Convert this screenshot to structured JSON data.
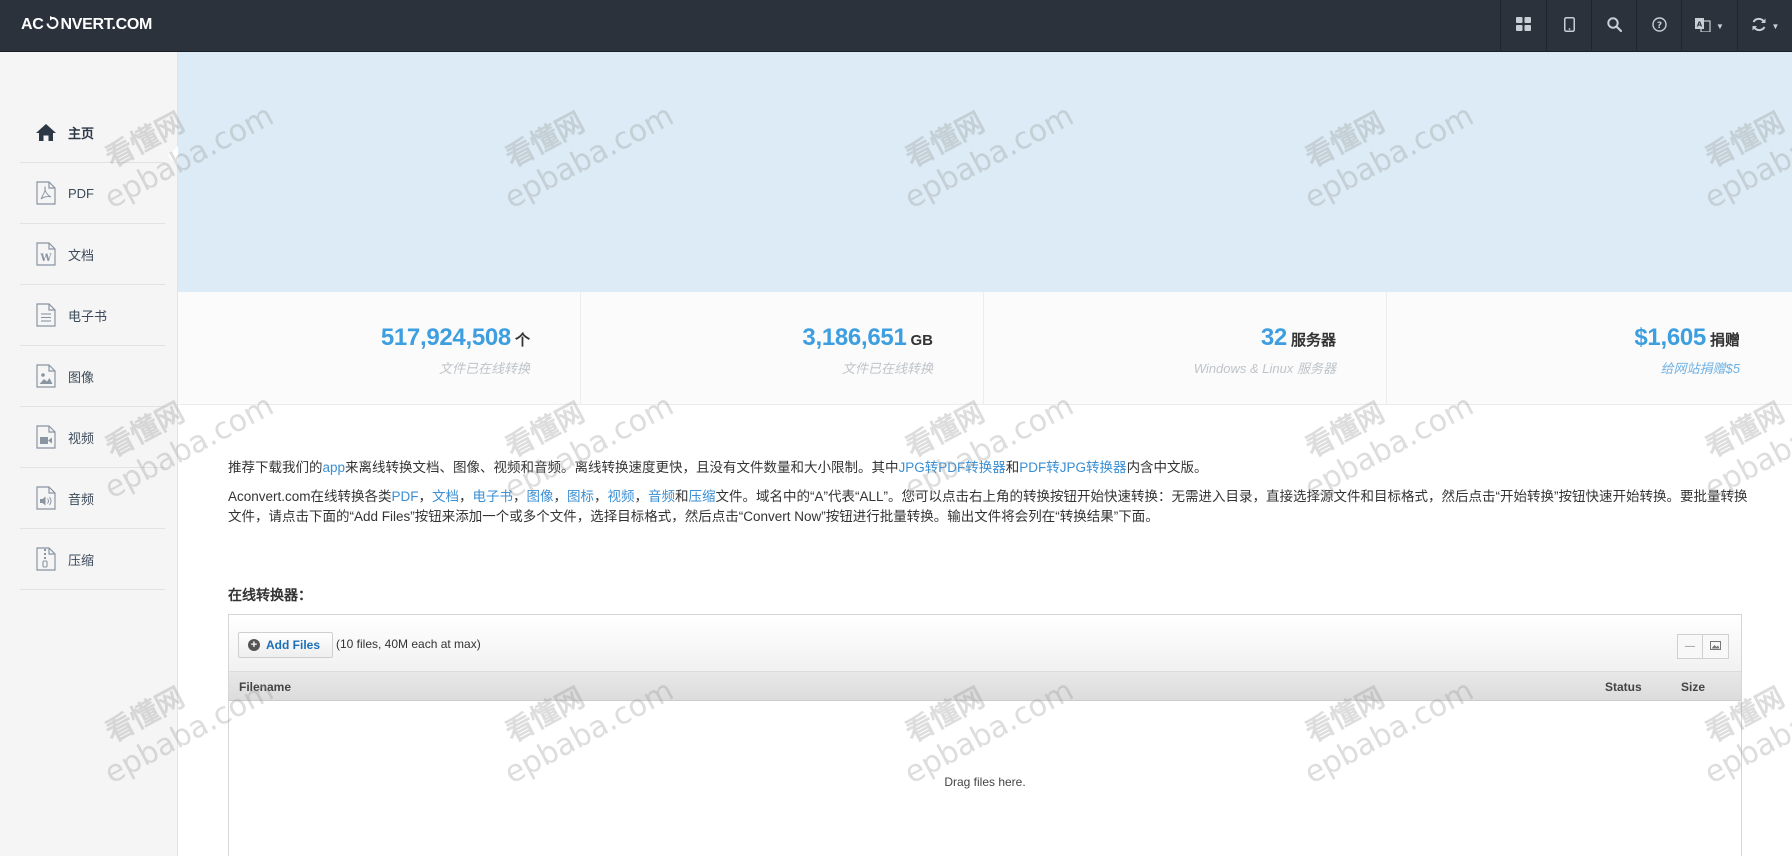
{
  "header": {
    "logo_left": "AC",
    "logo_right": "NVERT.COM",
    "nav_icons": [
      {
        "icon": "grid-icon",
        "name": "nav-grid"
      },
      {
        "icon": "tablet-icon",
        "name": "nav-mobile"
      },
      {
        "icon": "search-icon",
        "name": "nav-search"
      },
      {
        "icon": "help-icon",
        "name": "nav-help"
      },
      {
        "icon": "language-icon",
        "name": "nav-language"
      },
      {
        "icon": "refresh-icon",
        "name": "nav-convert"
      }
    ]
  },
  "sidebar": {
    "items": [
      {
        "label": "主页",
        "icon": "home-icon"
      },
      {
        "label": "PDF",
        "icon": "pdf-file-icon"
      },
      {
        "label": "文档",
        "icon": "word-file-icon"
      },
      {
        "label": "电子书",
        "icon": "ebook-file-icon"
      },
      {
        "label": "图像",
        "icon": "image-file-icon"
      },
      {
        "label": "视频",
        "icon": "video-file-icon"
      },
      {
        "label": "音频",
        "icon": "audio-file-icon"
      },
      {
        "label": "压缩",
        "icon": "archive-file-icon"
      }
    ]
  },
  "stats": [
    {
      "number": "517,924,508",
      "unit": "个",
      "sub": "文件已在线转换"
    },
    {
      "number": "3,186,651",
      "unit": "GB",
      "sub": "文件已在线转换"
    },
    {
      "number": "32",
      "unit": "服务器",
      "sub": "Windows & Linux 服务器"
    },
    {
      "number": "$1,605",
      "unit": "捐赠",
      "sub": "给网站捐赠$5"
    }
  ],
  "intro": {
    "p1": {
      "t1": "推荐下载我们的",
      "l1": "app",
      "t2": "来离线转换文档、图像、视频和音频。离线转换速度更快，且没有文件数量和大小限制。其中",
      "l2": "JPG转PDF转换器",
      "t3": "和",
      "l3": "PDF转JPG转换器",
      "t4": "内含中文版。"
    },
    "p2": {
      "t1": "Aconvert.com在线转换各类",
      "l_pdf": "PDF",
      "sep1": "，",
      "l_doc": "文档",
      "sep2": "，",
      "l_ebook": "电子书",
      "sep3": "，",
      "l_image": "图像",
      "sep4": "，",
      "l_icon": "图标",
      "sep5": "，",
      "l_video": "视频",
      "sep6": "，",
      "l_audio": "音频",
      "and": "和",
      "l_archive": "压缩",
      "t2": "文件。域名中的“A”代表“ALL”。您可以点击右上角的转换按钮开始快速转换：无需进入目录，直接选择源文件和目标格式，然后点击“开始转换”按钮快速开始转换。要批量转换文件，请点击下面的“Add Files”按钮来添加一个或多个文件，选择目标格式，然后点击“Convert Now”按钮进行批量转换。输出文件将会列在“转换结果”下面。"
    }
  },
  "converter": {
    "title": "在线转换器：",
    "add_files": "Add Files",
    "limit_note": "(10 files, 40M each at max)",
    "columns": {
      "filename": "Filename",
      "status": "Status",
      "size": "Size"
    },
    "drop_text": "Drag files here."
  },
  "watermark": {
    "cn": "看懂网",
    "en": "epbaba.com"
  },
  "colors": {
    "topbar": "#2b323c",
    "accent": "#3d9ee0",
    "banner": "#dcebf5",
    "link": "#3a8fd4"
  }
}
